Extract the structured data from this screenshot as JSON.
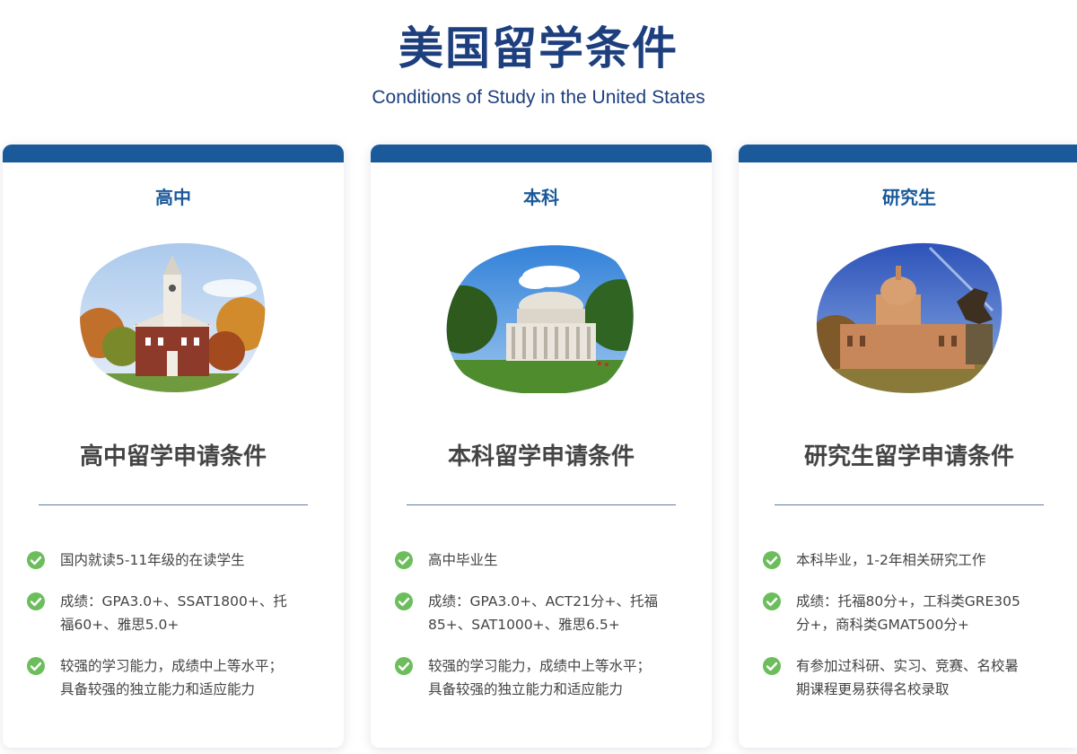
{
  "header": {
    "title": "美国留学条件",
    "subtitle": "Conditions of Study in the United States"
  },
  "colors": {
    "title": "#1e3f7e",
    "accent": "#1a5a9a",
    "check": "#6cbd5c",
    "body_text": "#444444"
  },
  "cards": [
    {
      "tag": "高中",
      "image_icon": "campus-clocktower-image",
      "heading": "高中留学申请条件",
      "requirements": [
        "国内就读5-11年级的在读学生",
        "成绩：GPA3.0+、SSAT1800+、托福60+、雅思5.0+",
        "较强的学习能力，成绩中上等水平；具备较强的独立能力和适应能力"
      ]
    },
    {
      "tag": "本科",
      "image_icon": "university-dome-image",
      "heading": "本科留学申请条件",
      "requirements": [
        "高中毕业生",
        "成绩：GPA3.0+、ACT21分+、托福85+、SAT1000+、雅思6.5+",
        "较强的学习能力，成绩中上等水平；具备较强的独立能力和适应能力"
      ]
    },
    {
      "tag": "研究生",
      "image_icon": "capitol-building-image",
      "heading": "研究生留学申请条件",
      "requirements": [
        "本科毕业，1-2年相关研究工作",
        "成绩：托福80分+，工科类GRE305分+，商科类GMAT500分+",
        "有参加过科研、实习、竞赛、名校暑期课程更易获得名校录取"
      ]
    }
  ]
}
